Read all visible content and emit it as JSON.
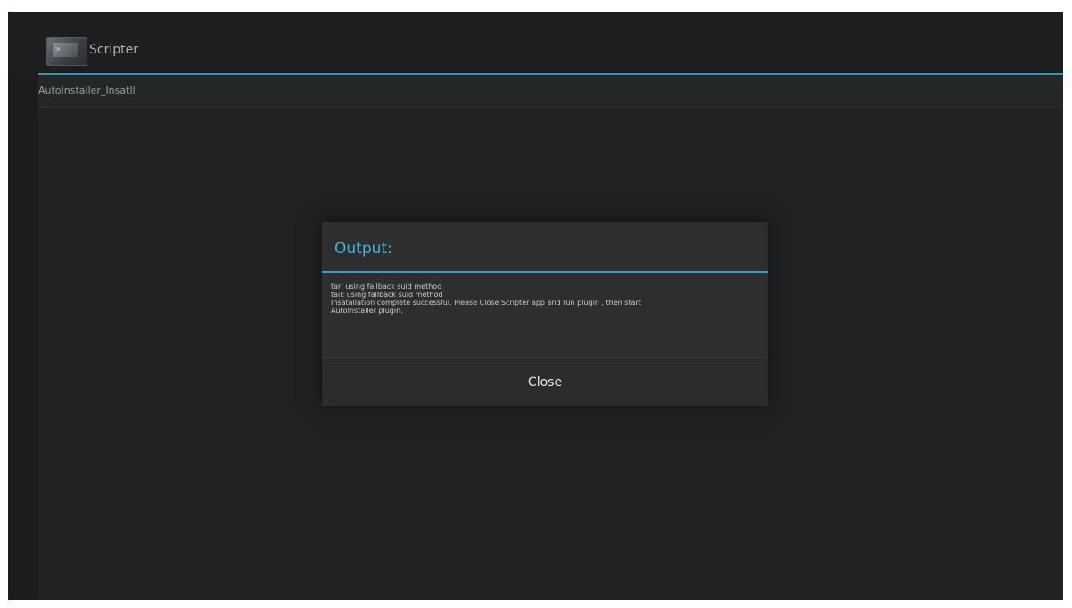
{
  "app": {
    "title": "Scripter",
    "icon": "terminal-icon"
  },
  "script": {
    "name": "AutoInstaller_Insatll"
  },
  "dialog": {
    "title": "Output:",
    "lines": [
      "tar: using fallback suid method",
      "tail: using fallback suid method",
      "Insatallation complete successful. Please Close Scripter app and run plugin , then start",
      "AutoInstaller plugin."
    ],
    "close_label": "Close"
  },
  "colors": {
    "accent": "#3c9cbf",
    "title": "#47b3d6",
    "background": "#1b1c1d"
  }
}
